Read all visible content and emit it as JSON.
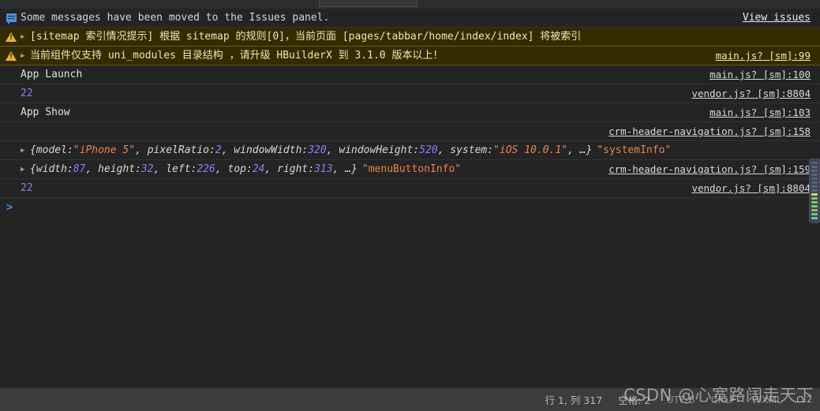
{
  "window": {
    "theme_bg": "#242424",
    "warn_bg": "#332b00",
    "statusbar_bg": "#3c3c3c",
    "accent_blue": "#3b8eea",
    "warn_icon_color": "#f0b429"
  },
  "console": {
    "view_issues_label": "View issues",
    "prompt_symbol": ">",
    "rows": [
      {
        "kind": "info",
        "icon": "message-icon",
        "text": "Some messages have been moved to the Issues panel.",
        "source": ""
      },
      {
        "kind": "warning",
        "icon": "warning-icon",
        "text": "[sitemap 索引情况提示] 根据 sitemap 的规则[0]，当前页面 [pages/tabbar/home/index/index] 将被索引",
        "source": ""
      },
      {
        "kind": "warning",
        "icon": "warning-icon",
        "expandable": true,
        "text": "当前组件仅支持 uni_modules 目录结构 ，请升级 HBuilderX 到 3.1.0 版本以上！",
        "source": "main.js? [sm]:99"
      },
      {
        "kind": "plain",
        "text": "App Launch",
        "source": "main.js? [sm]:100"
      },
      {
        "kind": "plain",
        "text": "22",
        "value_type": "number",
        "source": "vendor.js? [sm]:8804"
      },
      {
        "kind": "plain",
        "text": "App Show",
        "source": "main.js? [sm]:103"
      },
      {
        "kind": "plain",
        "text": "",
        "source": "crm-header-navigation.js? [sm]:158"
      }
    ],
    "object_rows": [
      {
        "disclosure": "▶",
        "open_brace": "{",
        "parts": [
          {
            "key": "model: ",
            "value": "\"iPhone 5\"",
            "value_type": "string"
          },
          {
            "key": ", pixelRatio: ",
            "value": "2",
            "value_type": "number"
          },
          {
            "key": ", windowWidth: ",
            "value": "320",
            "value_type": "number"
          },
          {
            "key": ", windowHeight: ",
            "value": "520",
            "value_type": "number"
          },
          {
            "key": ", system: ",
            "value": "\"iOS 10.0.1\"",
            "value_type": "string"
          }
        ],
        "ellipsis": ", …}",
        "label": "\"systemInfo\"",
        "source": ""
      },
      {
        "disclosure": "▶",
        "open_brace": "{",
        "parts": [
          {
            "key": "width: ",
            "value": "87",
            "value_type": "number"
          },
          {
            "key": ", height: ",
            "value": "32",
            "value_type": "number"
          },
          {
            "key": ", left: ",
            "value": "226",
            "value_type": "number"
          },
          {
            "key": ", top: ",
            "value": "24",
            "value_type": "number"
          },
          {
            "key": ", right: ",
            "value": "313",
            "value_type": "number"
          }
        ],
        "ellipsis": ", …}",
        "label": "\"menuButtonInfo\"",
        "source": "crm-header-navigation.js? [sm]:159"
      }
    ],
    "last_row": {
      "text": "22",
      "source": "vendor.js? [sm]:8804"
    }
  },
  "minimap": {
    "marks": [
      "gray",
      "gray",
      "gray",
      "gray",
      "gray",
      "gray",
      "gray",
      "gray",
      "yellow",
      "green",
      "green",
      "green",
      "green",
      "green",
      "teal"
    ]
  },
  "statusbar": {
    "cursor_position": "行 1, 列 317",
    "indent": "空格: 2",
    "encoding": "UTF-8",
    "line_ending": "CRLF",
    "language": "WXML",
    "notification_count": "2"
  },
  "watermark": {
    "text": "CSDN @心宽路阔走天下"
  }
}
